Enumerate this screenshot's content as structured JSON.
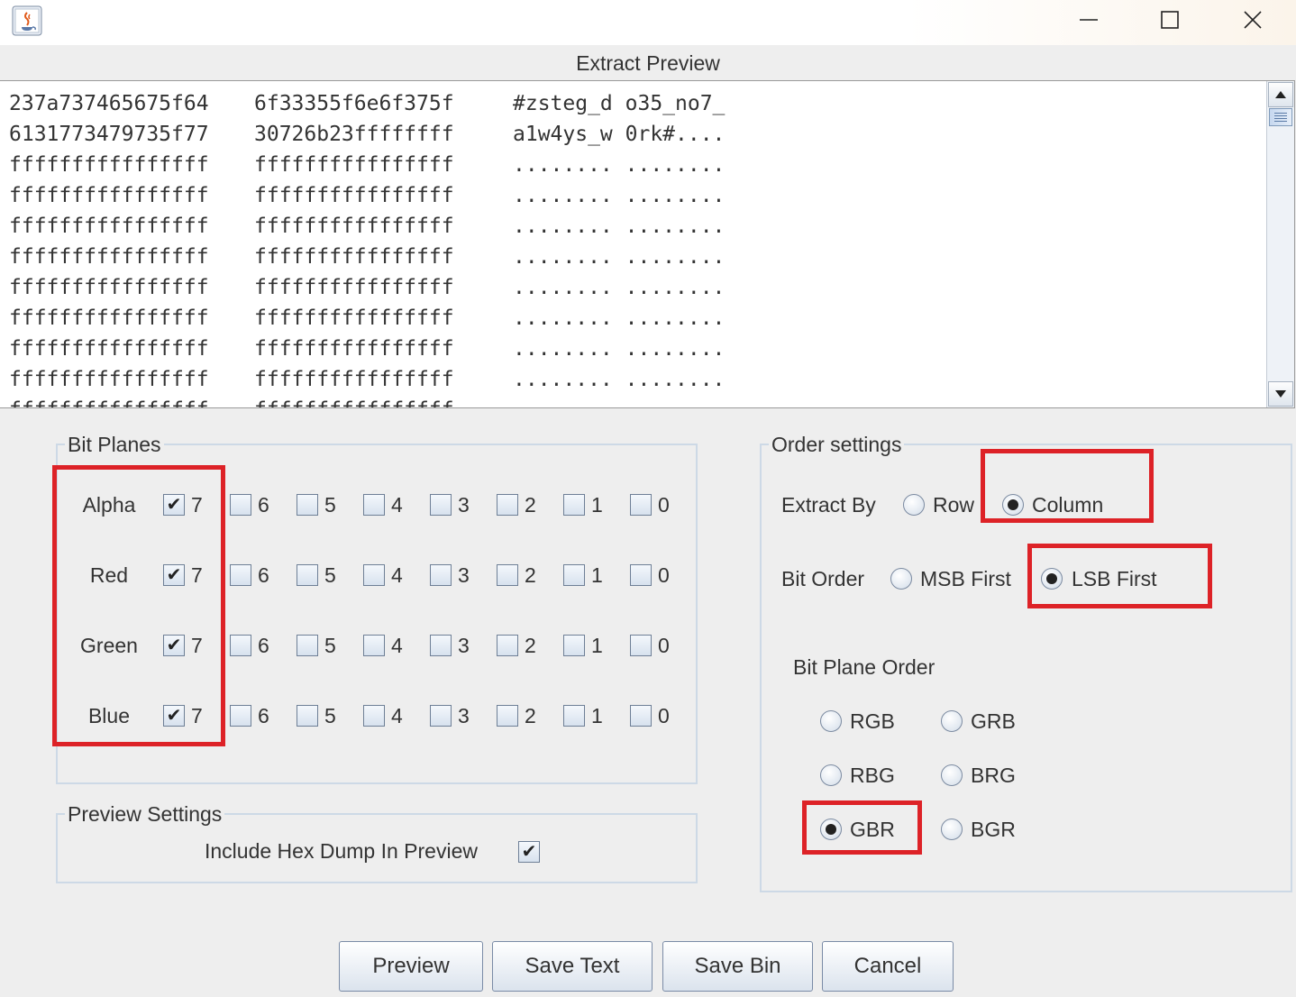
{
  "window": {
    "icon": "java-icon",
    "controls": [
      "minimize-icon",
      "maximize-icon",
      "close-icon"
    ]
  },
  "preview": {
    "title": "Extract Preview",
    "rows": [
      [
        "237a737465675f64",
        "6f33355f6e6f375f",
        "#zsteg_d o35_no7_"
      ],
      [
        "6131773479735f77",
        "30726b23ffffffff",
        "a1w4ys_w 0rk#...."
      ],
      [
        "ffffffffffffffff",
        "ffffffffffffffff",
        "........ ........"
      ],
      [
        "ffffffffffffffff",
        "ffffffffffffffff",
        "........ ........"
      ],
      [
        "ffffffffffffffff",
        "ffffffffffffffff",
        "........ ........"
      ],
      [
        "ffffffffffffffff",
        "ffffffffffffffff",
        "........ ........"
      ],
      [
        "ffffffffffffffff",
        "ffffffffffffffff",
        "........ ........"
      ],
      [
        "ffffffffffffffff",
        "ffffffffffffffff",
        "........ ........"
      ],
      [
        "ffffffffffffffff",
        "ffffffffffffffff",
        "........ ........"
      ],
      [
        "ffffffffffffffff",
        "ffffffffffffffff",
        "........ ........"
      ],
      [
        "ffffffffffffffff",
        "ffffffffffffffff",
        "........ ........"
      ]
    ]
  },
  "bit_planes": {
    "title": "Bit Planes",
    "channels": [
      {
        "name": "Alpha",
        "checked": [
          7
        ]
      },
      {
        "name": "Red",
        "checked": [
          7
        ]
      },
      {
        "name": "Green",
        "checked": [
          7
        ]
      },
      {
        "name": "Blue",
        "checked": [
          7
        ]
      }
    ],
    "bits": [
      "7",
      "6",
      "5",
      "4",
      "3",
      "2",
      "1",
      "0"
    ]
  },
  "preview_settings": {
    "title": "Preview Settings",
    "hex_dump_label": "Include Hex Dump In Preview",
    "hex_dump_checked": true
  },
  "order_settings": {
    "title": "Order settings",
    "extract_by": {
      "label": "Extract By",
      "options": [
        "Row",
        "Column"
      ],
      "selected": "Column"
    },
    "bit_order": {
      "label": "Bit Order",
      "options": [
        "MSB First",
        "LSB First"
      ],
      "selected": "LSB First"
    },
    "bit_plane_order": {
      "label": "Bit Plane Order",
      "options": [
        "RGB",
        "GRB",
        "RBG",
        "BRG",
        "GBR",
        "BGR"
      ],
      "selected": "GBR"
    }
  },
  "buttons": {
    "preview": "Preview",
    "save_text": "Save Text",
    "save_bin": "Save Bin",
    "cancel": "Cancel"
  },
  "highlight_color": "#dd2227"
}
